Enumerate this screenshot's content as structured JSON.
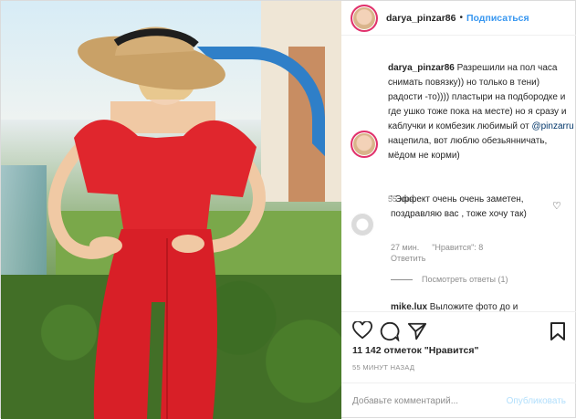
{
  "header": {
    "username": "darya_pinzar86",
    "dot": "•",
    "follow_label": "Подписаться"
  },
  "caption": {
    "username": "darya_pinzar86",
    "text_before_mention": " Разрешили на пол часа снимать повязку)) но только в тени) радости -то)))) пластыри на подбородке и где ушко тоже пока на месте) но я сразу и каблучки и комбезик любимый от ",
    "mention": "@pinzarru",
    "text_after_mention": " нацепила, вот люблю обезьянничать, мёдом не корми)",
    "time": "55 мин."
  },
  "reply": {
    "text": "' Эффект очень очень заметен, поздравляю вас , тоже хочу так)",
    "time": "27 мин.",
    "likes": "\"Нравится\": 8",
    "reply_label": "Ответить"
  },
  "view_replies_label": "Посмотреть ответы (1)",
  "next_comment": {
    "username": "mike.lux",
    "text": " Выложите фото до и"
  },
  "actions": {
    "likes_text": "11 142 отметок \"Нравится\"",
    "time_ago": "55 МИНУТ НАЗАД"
  },
  "add_comment": {
    "placeholder": "Добавьте комментарий...",
    "post_label": "Опубликовать"
  },
  "colors": {
    "link": "#3897f0",
    "secondary": "#8e8e8e",
    "dress": "#e0262d"
  }
}
